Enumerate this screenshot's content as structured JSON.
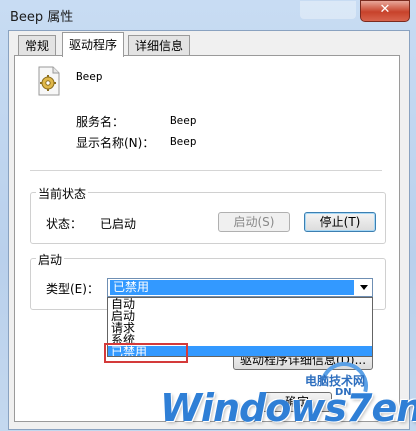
{
  "window": {
    "title": "Beep 属性",
    "close_glyph": "✕"
  },
  "tabs": [
    {
      "label": "常规"
    },
    {
      "label": "驱动程序"
    },
    {
      "label": "详细信息"
    }
  ],
  "driver": {
    "name": "Beep",
    "service_name_label": "服务名：",
    "service_name_value": "Beep",
    "display_name_label": "显示名称(N)：",
    "display_name_value": "Beep"
  },
  "current_status": {
    "group_label": "当前状态",
    "status_label": "状态：",
    "status_value": "已启动",
    "start_button": "启动(S)",
    "stop_button": "停止(T)"
  },
  "startup": {
    "group_label": "启动",
    "type_label": "类型(E)：",
    "selected_value": "已禁用",
    "options": [
      "自动",
      "启动",
      "请求",
      "系统",
      "已禁用"
    ],
    "selected_index": 4,
    "details_button": "驱动程序详细信息(D)..."
  },
  "footer": {
    "ok_button": "确定"
  },
  "watermark": {
    "site_name": "电脑技术网",
    "site_tag": "DN",
    "logo_text": "Windows7en"
  },
  "icons": {
    "driver_icon": "gear-icon",
    "close": "close-icon",
    "dropdown": "chevron-down-icon"
  },
  "colors": {
    "selection": "#3399ff",
    "highlight_box": "#d43a3a",
    "titlebar": "#c8dcf3",
    "close_button": "#c7422b"
  }
}
